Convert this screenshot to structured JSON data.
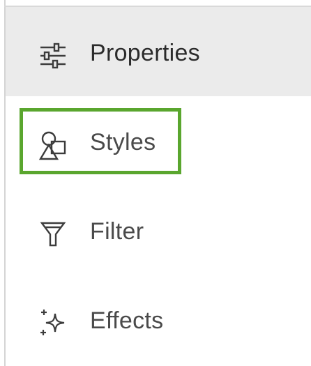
{
  "panel": {
    "items": [
      {
        "label": "Properties",
        "icon": "sliders-icon",
        "active": true
      },
      {
        "label": "Styles",
        "icon": "shapes-icon",
        "active": false
      },
      {
        "label": "Filter",
        "icon": "funnel-icon",
        "active": false
      },
      {
        "label": "Effects",
        "icon": "sparkle-icon",
        "active": false
      }
    ],
    "highlighted_item": "Styles"
  },
  "colors": {
    "active_background": "#ebebeb",
    "highlight_border": "#5aa62e",
    "text": "#4a4a4a",
    "icon": "#3c3c3c"
  }
}
